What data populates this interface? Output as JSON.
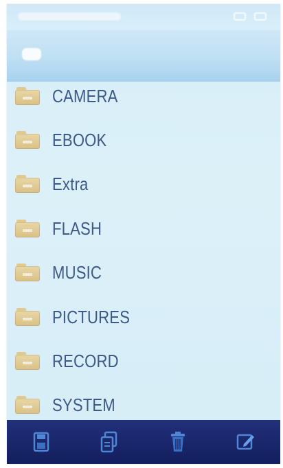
{
  "folders": [
    {
      "label": "CAMERA",
      "icon": "folder-icon"
    },
    {
      "label": "EBOOK",
      "icon": "folder-icon"
    },
    {
      "label": "Extra",
      "icon": "folder-icon"
    },
    {
      "label": "FLASH",
      "icon": "folder-icon"
    },
    {
      "label": "MUSIC",
      "icon": "folder-icon"
    },
    {
      "label": "PICTURES",
      "icon": "folder-icon"
    },
    {
      "label": "RECORD",
      "icon": "folder-icon"
    },
    {
      "label": "SYSTEM",
      "icon": "folder-icon"
    }
  ],
  "toolbar": {
    "buttons": [
      "save-icon",
      "copy-icon",
      "trash-icon",
      "edit-icon"
    ]
  },
  "colors": {
    "list_background": "#d8eef8",
    "label_text": "#3d5a87",
    "toolbar": "#1a2769",
    "folder": "#dcc68d"
  }
}
